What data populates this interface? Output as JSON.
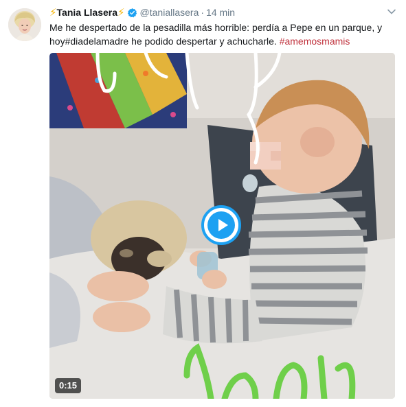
{
  "author": {
    "name": "Tania Llasera",
    "name_prefix_emoji": "⚡",
    "name_suffix_emoji": "⚡",
    "handle": "@taniallasera",
    "verified": true,
    "avatar_icon": "avatar-photo"
  },
  "meta": {
    "separator": "·",
    "timestamp": "14 min"
  },
  "tweet": {
    "text_part1": "Me he despertado de la pesadilla más horrible: perdía a Pepe en un parque, y hoy",
    "hashtag1": "#diadelamadre",
    "text_part2": " he podido despertar y achucharle. ",
    "hashtag2": "#amemosmamis"
  },
  "media": {
    "type": "video",
    "duration": "0:15",
    "play_icon": "play-icon"
  },
  "colors": {
    "accent": "#1da1f2",
    "hashtag": "#c0313c",
    "secondary_text": "#657786",
    "lightning": "#f5b301"
  }
}
